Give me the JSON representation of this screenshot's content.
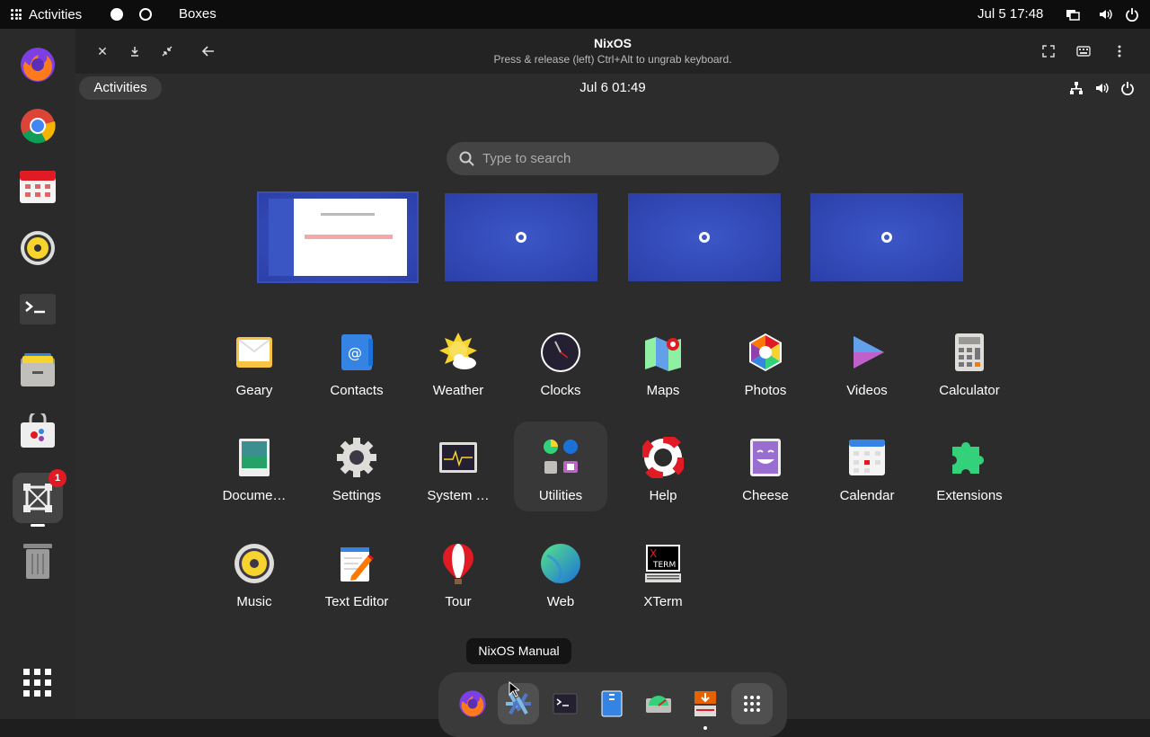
{
  "host": {
    "activities_label": "Activities",
    "app_name": "Boxes",
    "clock": "Jul 5  17:48",
    "dock_badge": "1"
  },
  "window": {
    "title": "NixOS",
    "subtitle": "Press & release (left) Ctrl+Alt to ungrab keyboard."
  },
  "guest": {
    "activities_label": "Activities",
    "clock": "Jul 6  01:49",
    "search_placeholder": "Type to search",
    "apps": [
      {
        "label": "Geary",
        "icon": "mail-icon"
      },
      {
        "label": "Contacts",
        "icon": "contacts-icon"
      },
      {
        "label": "Weather",
        "icon": "weather-icon"
      },
      {
        "label": "Clocks",
        "icon": "clock-icon"
      },
      {
        "label": "Maps",
        "icon": "maps-icon"
      },
      {
        "label": "Photos",
        "icon": "photos-icon"
      },
      {
        "label": "Videos",
        "icon": "videos-icon"
      },
      {
        "label": "Calculator",
        "icon": "calculator-icon"
      },
      {
        "label": "Docume…",
        "icon": "document-viewer-icon"
      },
      {
        "label": "Settings",
        "icon": "gear-icon"
      },
      {
        "label": "System …",
        "icon": "system-monitor-icon"
      },
      {
        "label": "Utilities",
        "icon": "folder-icon"
      },
      {
        "label": "Help",
        "icon": "lifebuoy-icon"
      },
      {
        "label": "Cheese",
        "icon": "cheese-icon"
      },
      {
        "label": "Calendar",
        "icon": "calendar-icon"
      },
      {
        "label": "Extensions",
        "icon": "puzzle-icon"
      },
      {
        "label": "Music",
        "icon": "music-icon"
      },
      {
        "label": "Text Editor",
        "icon": "text-editor-icon"
      },
      {
        "label": "Tour",
        "icon": "balloon-icon"
      },
      {
        "label": "Web",
        "icon": "web-icon"
      },
      {
        "label": "XTerm",
        "icon": "xterm-icon"
      }
    ],
    "tooltip": "NixOS Manual",
    "colors": {
      "workspace_blue": "#3c57c8",
      "accent_red": "#e01b24"
    }
  }
}
